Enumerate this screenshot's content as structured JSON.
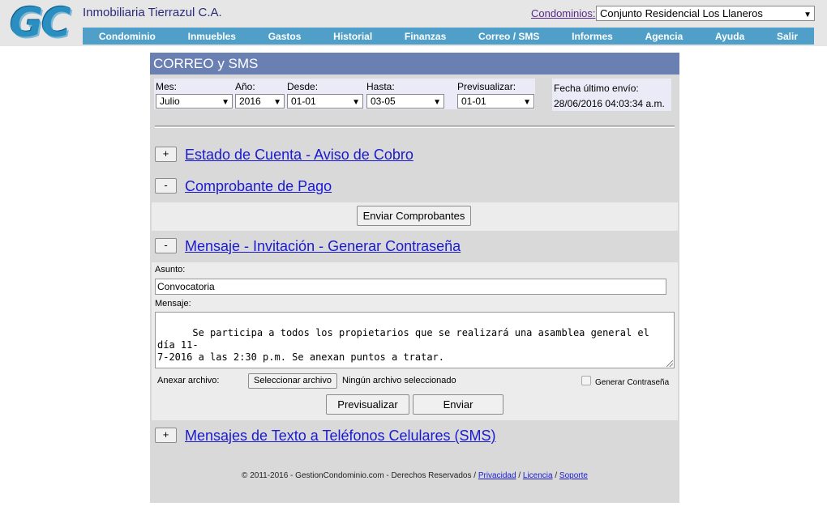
{
  "header": {
    "logo_text": "GC",
    "company": "Inmobiliaria Tierrazul C.A.",
    "condo_label": "Condominios:",
    "condo_selected": "Conjunto Residencial Los Llaneros"
  },
  "nav": [
    "Condominio",
    "Inmuebles",
    "Gastos",
    "Historial",
    "Finanzas",
    "Correo / SMS",
    "Informes",
    "Agencia",
    "Ayuda",
    "Salir"
  ],
  "panel": {
    "title": "CORREO y SMS",
    "filters": {
      "mes_label": "Mes:",
      "mes_value": "Julio",
      "anio_label": "Año:",
      "anio_value": "2016",
      "desde_label": "Desde:",
      "desde_value": "01-01",
      "hasta_label": "Hasta:",
      "hasta_value": "03-05",
      "previsualizar_label": "Previsualizar:",
      "previsualizar_value": "01-01"
    },
    "last_send": {
      "label": "Fecha último envío:",
      "value": "28/06/2016 04:03:34 a.m."
    },
    "sections": {
      "estado": {
        "toggle": "+",
        "title": "Estado de Cuenta - Aviso de Cobro"
      },
      "comprobante": {
        "toggle": "-",
        "title": "Comprobante de Pago",
        "button": "Enviar Comprobantes"
      },
      "mensaje": {
        "toggle": "-",
        "title": "Mensaje - Invitación - Generar Contraseña",
        "asunto_label": "Asunto:",
        "asunto_value": "Convocatoria",
        "mensaje_label": "Mensaje:",
        "mensaje_value": "Se participa a todos los propietarios que se realizará una asamblea general el día 11-\n7-2016 a las 2:30 p.m. Se anexan puntos a tratar.\n\nFeliz Día para todos.",
        "anexar_label": "Anexar archivo:",
        "file_button": "Seleccionar archivo",
        "file_status": "Ningún archivo seleccionado",
        "generar_label": "Generar Contraseña",
        "preview_button": "Previsualizar",
        "send_button": "Enviar"
      },
      "sms": {
        "toggle": "+",
        "title": "Mensajes de Texto a Teléfonos Celulares (SMS)"
      }
    },
    "footer": {
      "text": "© 2011-2016 - GestionCondominio.com - Derechos Reservados /",
      "privacidad": "Privacidad",
      "licencia": "Licencia",
      "soporte": "Soporte",
      "sep": "/"
    }
  }
}
